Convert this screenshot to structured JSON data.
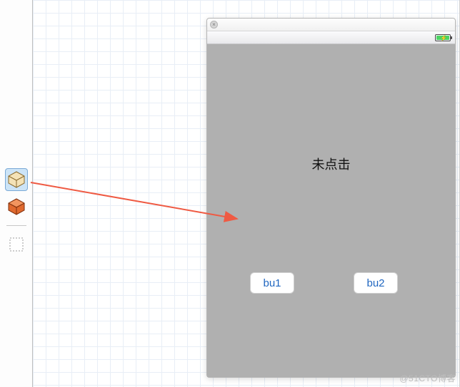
{
  "toolbar": {
    "items": [
      {
        "name": "object-cube-blue",
        "selected": true
      },
      {
        "name": "object-cube-orange",
        "selected": false
      }
    ],
    "after_divider": [
      {
        "name": "selection-rect",
        "selected": false
      }
    ]
  },
  "phone": {
    "close_glyph": "×",
    "statusbar": {
      "battery_charging": true,
      "battery_fill_color": "#4cd464"
    },
    "label_text": "未点击",
    "button1_label": "bu1",
    "button2_label": "bu2"
  },
  "watermark": "@51CTO博客"
}
